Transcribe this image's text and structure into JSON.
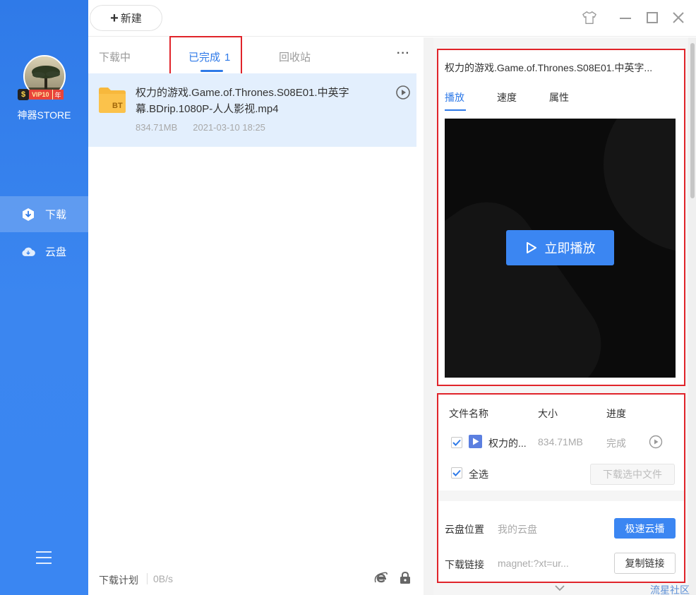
{
  "sidebar": {
    "vip_badge": {
      "bolt": "$",
      "vip": "VIP10",
      "year": "年"
    },
    "username": "神器STORE",
    "items": [
      {
        "label": "下载",
        "icon": "download-icon",
        "active": true
      },
      {
        "label": "云盘",
        "icon": "cloud-icon",
        "active": false
      }
    ],
    "menu_icon": "hamburger-menu-icon"
  },
  "toolbar": {
    "new_label": "新建",
    "icons": [
      "skin-icon",
      "minimize-icon",
      "maximize-icon",
      "close-icon"
    ]
  },
  "list": {
    "tabs": [
      {
        "label": "下载中",
        "count": ""
      },
      {
        "label": "已完成",
        "count": "1"
      },
      {
        "label": "回收站",
        "count": ""
      }
    ],
    "active_tab": "已完成",
    "more": "···",
    "items": [
      {
        "icon_text": "BT",
        "name": "权力的游戏.Game.of.Thrones.S08E01.中英字幕.BDrip.1080P-人人影视.mp4",
        "size": "834.71MB",
        "date": "2021-03-10 18:25"
      }
    ],
    "status": {
      "plan": "下载计划",
      "speed": "0B/s"
    }
  },
  "detail": {
    "title": "权力的游戏.Game.of.Thrones.S08E01.中英字...",
    "tabs": [
      "播放",
      "速度",
      "属性"
    ],
    "active_tab": "播放",
    "play_now": "立即播放",
    "files": {
      "headers": {
        "name": "文件名称",
        "size": "大小",
        "progress": "进度"
      },
      "rows": [
        {
          "name": "权力的...",
          "size": "834.71MB",
          "progress": "完成",
          "checked": true
        }
      ],
      "select_all": "全选",
      "download_selected": "下载选中文件"
    },
    "cloud": {
      "location_label": "云盘位置",
      "location_value": "我的云盘",
      "fast_cloud": "极速云播",
      "link_label": "下载链接",
      "link_value": "magnet:?xt=ur...",
      "copy_link": "复制链接"
    }
  },
  "watermark": "流星社区",
  "colors": {
    "accent": "#2f7ae8",
    "highlight_box": "#e0242a",
    "selected_row": "#e3effd"
  }
}
